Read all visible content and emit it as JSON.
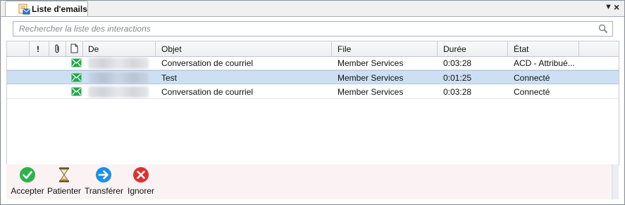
{
  "tab": {
    "title": "Liste d'emails",
    "icon": "email-list-icon"
  },
  "window_controls": {
    "menu": "▼",
    "close": "×"
  },
  "search": {
    "placeholder": "Rechercher la liste des interactions",
    "icon": "search-icon"
  },
  "columns": {
    "priority": "!",
    "attachment": "attachment-icon",
    "document": "document-icon",
    "de": "De",
    "objet": "Objet",
    "file": "File",
    "duree": "Durée",
    "etat": "État"
  },
  "rows": [
    {
      "objet": "Conversation de courriel",
      "file": "Member Services",
      "duree": "0:03:28",
      "etat": "ACD - Attribué...",
      "selected": false
    },
    {
      "objet": "Test",
      "file": "Member Services",
      "duree": "0:01:25",
      "etat": "Connecté",
      "selected": true
    },
    {
      "objet": "Conversation de courriel",
      "file": "Member Services",
      "duree": "0:03:28",
      "etat": "Connecté",
      "selected": false
    }
  ],
  "actions": [
    {
      "label": "Accepter",
      "icon": "accept-icon",
      "color": "#2db34a"
    },
    {
      "label": "Patienter",
      "icon": "hourglass-icon",
      "color": "#8a7a5a"
    },
    {
      "label": "Transférer",
      "icon": "transfer-icon",
      "color": "#1e90e6"
    },
    {
      "label": "Ignorer",
      "icon": "ignore-icon",
      "color": "#e03030"
    }
  ]
}
